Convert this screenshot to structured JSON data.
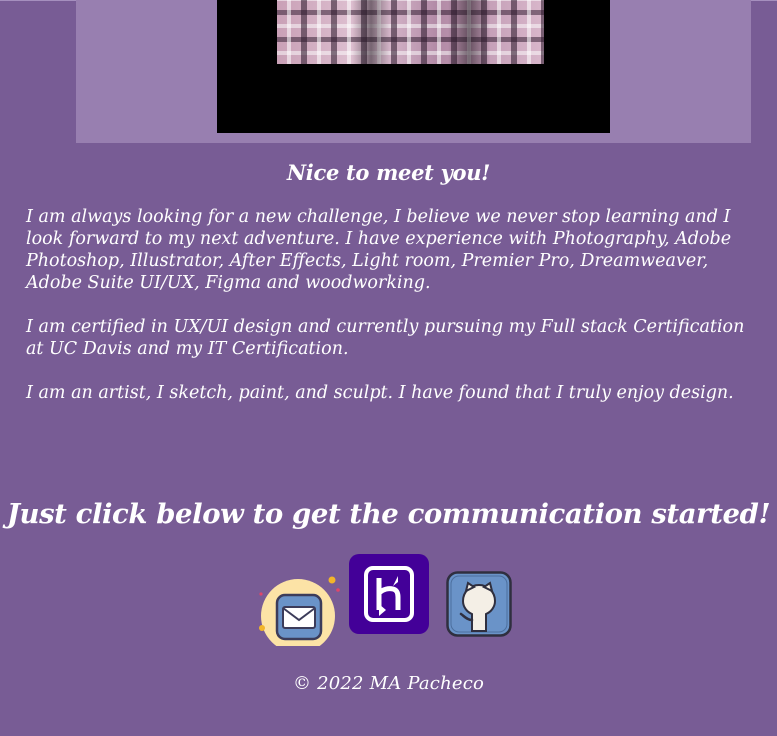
{
  "greeting": "Nice to meet you!",
  "bio": {
    "paragraphs": [
      "I am always looking for a new challenge, I believe we never stop learning and I look forward to my next adventure. I have experience with Photography, Adobe Photoshop, Illustrator, After Effects, Light room, Premier Pro, Dreamweaver, Adobe Suite UI/UX, Figma and woodworking.",
      "I am certified in UX/UI design and currently pursuing my Full stack Certification at UC Davis and my IT Certification.",
      "I am an artist, I sketch, paint, and sculpt. I have found that I truly enjoy design."
    ]
  },
  "cta": "Just click below to get the communication started!",
  "links": [
    {
      "icon": "email-icon"
    },
    {
      "icon": "heroku-icon"
    },
    {
      "icon": "github-icon"
    }
  ],
  "footer": "© 2022 MA Pacheco",
  "colors": {
    "background": "#785c95",
    "panel": "#987fb0",
    "heroku": "#430098",
    "mail_circle": "#fce3a6",
    "icon_blue": "#6a93c8"
  }
}
